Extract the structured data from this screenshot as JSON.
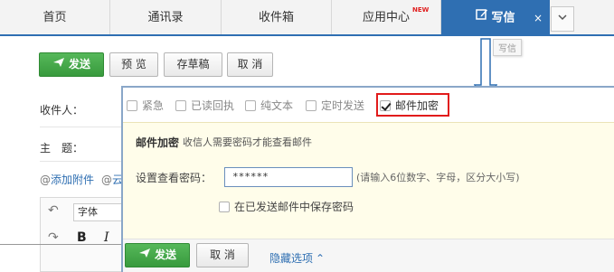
{
  "tabs": [
    {
      "label": "首页"
    },
    {
      "label": "通讯录"
    },
    {
      "label": "收件箱"
    },
    {
      "label": "应用中心",
      "badge": "NEW"
    },
    {
      "label": "写信",
      "close": "×"
    }
  ],
  "tooltip": "写信",
  "toolbar": {
    "send": "发送",
    "preview": "预 览",
    "save_draft": "存草稿",
    "cancel": "取 消"
  },
  "form": {
    "recipient_label": "收件人：",
    "subject_label": "主　题：",
    "attach_link": "添加附件",
    "cloud_link": "云"
  },
  "editor": {
    "font_select": "字体",
    "bold": "B",
    "italic": "I"
  },
  "options": [
    {
      "label": "紧急",
      "checked": false
    },
    {
      "label": "已读回执",
      "checked": false
    },
    {
      "label": "纯文本",
      "checked": false
    },
    {
      "label": "定时发送",
      "checked": false
    },
    {
      "label": "邮件加密",
      "checked": true
    }
  ],
  "encryption": {
    "title": "邮件加密",
    "description": "收信人需要密码才能查看邮件",
    "password_label": "设置查看密码：",
    "password_value": "******",
    "password_hint": "(请输入6位数字、字母，区分大小写)",
    "save_password_label": "在已发送邮件中保存密码"
  },
  "bottom": {
    "send": "发送",
    "cancel": "取 消",
    "hide_options": "隐藏选项"
  },
  "colors": {
    "accent": "#2f6fb2",
    "send_green": "#44a848",
    "highlight_red": "#e11b1b",
    "encryption_bg": "#fffdea"
  }
}
